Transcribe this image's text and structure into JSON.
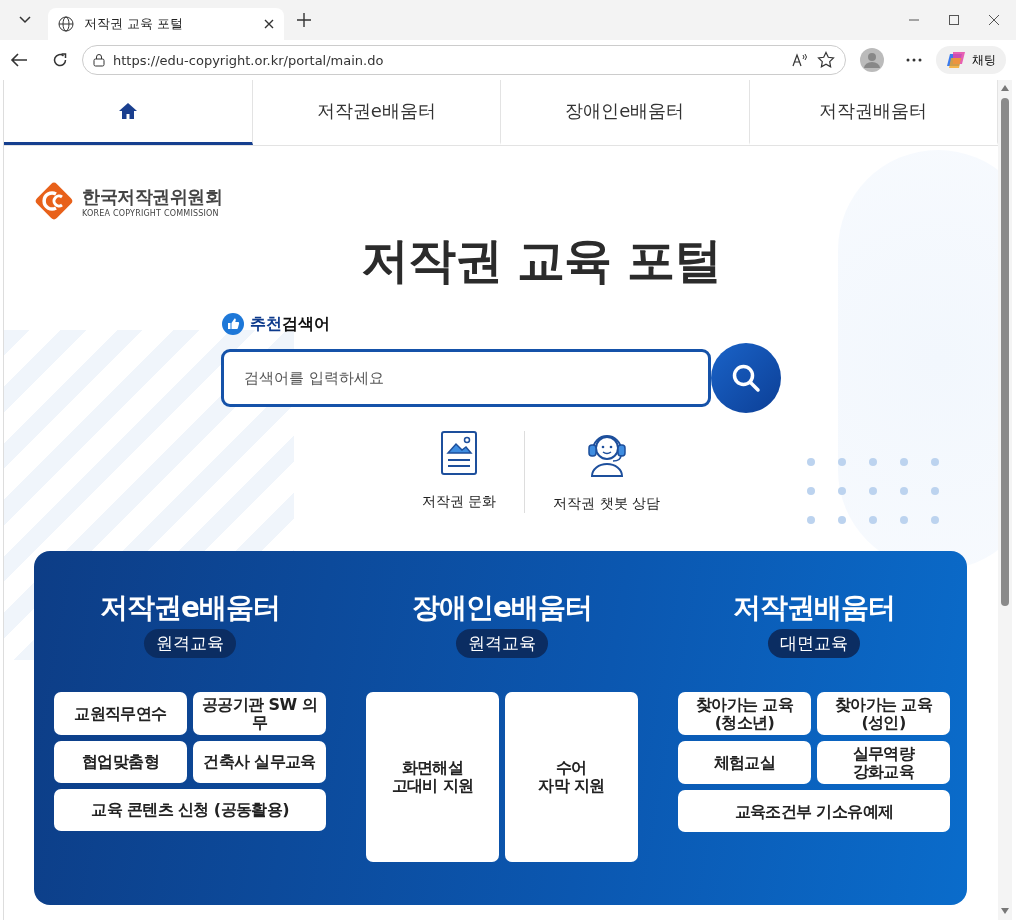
{
  "browser": {
    "tab_title": "저작권 교육 포털",
    "url": "https://edu-copyright.or.kr/portal/main.do",
    "chat_label": "채팅"
  },
  "nav": [
    {
      "kind": "home",
      "selected": true
    },
    {
      "kind": "text",
      "label": "저작권e배움터",
      "selected": false
    },
    {
      "kind": "text",
      "label": "장애인e배움터",
      "selected": false
    },
    {
      "kind": "text",
      "label": "저작권배움터",
      "selected": false
    }
  ],
  "logo": {
    "name": "한국저작권위원회",
    "subtitle": "KOREA COPYRIGHT COMMISSION"
  },
  "title": "저작권 교육 포털",
  "search": {
    "label_highlight": "추천",
    "label_rest": "검색어",
    "placeholder": "검색어를 입력하세요"
  },
  "quick_links": [
    {
      "kind": "document",
      "label": "저작권 문화"
    },
    {
      "kind": "headset",
      "label": "저작권 챗봇 상담"
    }
  ],
  "programs": [
    {
      "title": "저작권e배움터",
      "badge": "원격교육",
      "items": [
        {
          "label": "교원직무연수",
          "wide": false
        },
        {
          "label": "공공기관 SW 의무",
          "wide": false
        },
        {
          "label": "협업맞춤형",
          "wide": false
        },
        {
          "label": "건축사 실무교육",
          "wide": false
        },
        {
          "label": "교육 콘텐츠 신청 (공동활용)",
          "wide": true
        }
      ]
    },
    {
      "title": "장애인e배움터",
      "badge": "원격교육",
      "items": [
        {
          "label": "화면해설\n고대비 지원",
          "wide": false
        },
        {
          "label": "수어\n자막 지원",
          "wide": false
        }
      ]
    },
    {
      "title": "저작권배움터",
      "badge": "대면교육",
      "items": [
        {
          "label": "찾아가는 교육\n(청소년)",
          "wide": false
        },
        {
          "label": "찾아가는 교육\n(성인)",
          "wide": false
        },
        {
          "label": "체험교실",
          "wide": false
        },
        {
          "label": "실무역량\n강화교육",
          "wide": false
        },
        {
          "label": "교육조건부 기소유예제",
          "wide": true
        }
      ]
    }
  ]
}
